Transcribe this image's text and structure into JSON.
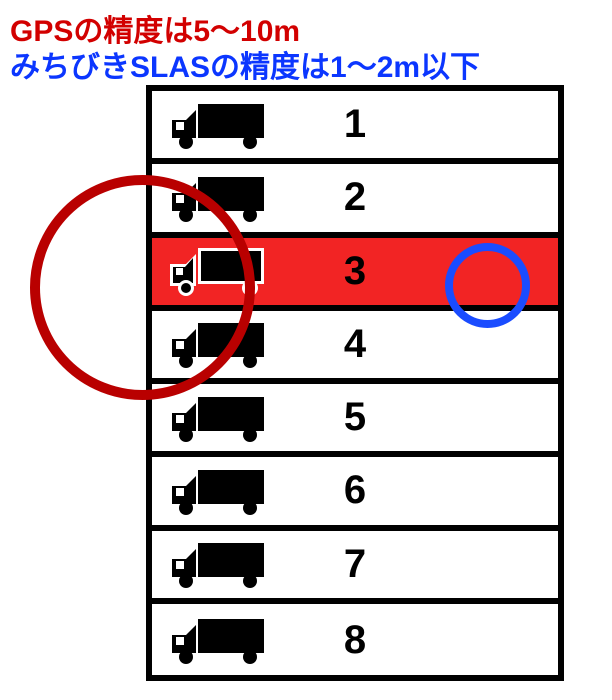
{
  "title_gps": "GPSの精度は5～10m",
  "title_slas": "みちびきSLASの精度は1～2m以下",
  "highlight_lane_index": 2,
  "lanes": [
    {
      "num": "1"
    },
    {
      "num": "2"
    },
    {
      "num": "3"
    },
    {
      "num": "4"
    },
    {
      "num": "5"
    },
    {
      "num": "6"
    },
    {
      "num": "7"
    },
    {
      "num": "8"
    }
  ],
  "circles": {
    "gps": {
      "color": "#b90000"
    },
    "slas": {
      "color": "#1a4cff"
    }
  }
}
